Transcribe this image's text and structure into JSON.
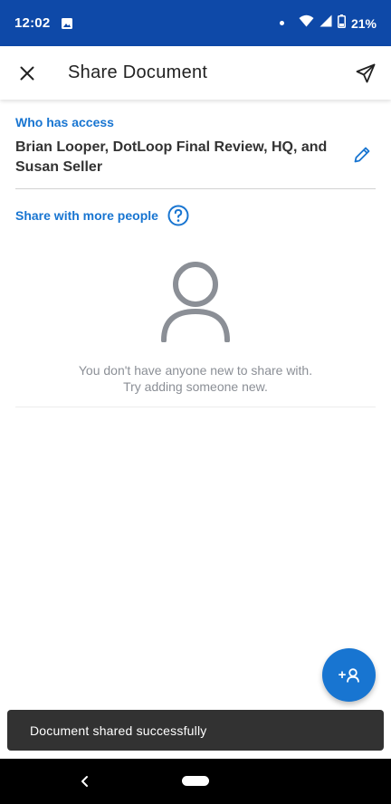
{
  "status_bar": {
    "time": "12:02",
    "battery": "21%",
    "icons": [
      "image-icon",
      "dot-icon",
      "wifi-icon",
      "signal-icon",
      "battery-icon"
    ]
  },
  "app_bar": {
    "title": "Share Document",
    "close_icon": "close-icon",
    "send_icon": "send-icon"
  },
  "access": {
    "label": "Who has access",
    "names": "Brian Looper, DotLoop Final Review, HQ, and Susan Seller",
    "edit_icon": "pencil-icon"
  },
  "share_more": {
    "label": "Share with more people",
    "help_icon": "help-icon"
  },
  "empty_state": {
    "icon": "person-icon",
    "line1": "You don't have anyone new to share with.",
    "line2": "Try adding someone new."
  },
  "fab": {
    "label": "+",
    "icon": "add-person-icon"
  },
  "snackbar": {
    "message": "Document shared successfully"
  },
  "colors": {
    "status_bar": "#0e49a8",
    "accent": "#1875d1",
    "snackbar": "#323232",
    "muted_text": "#8b8f96"
  }
}
